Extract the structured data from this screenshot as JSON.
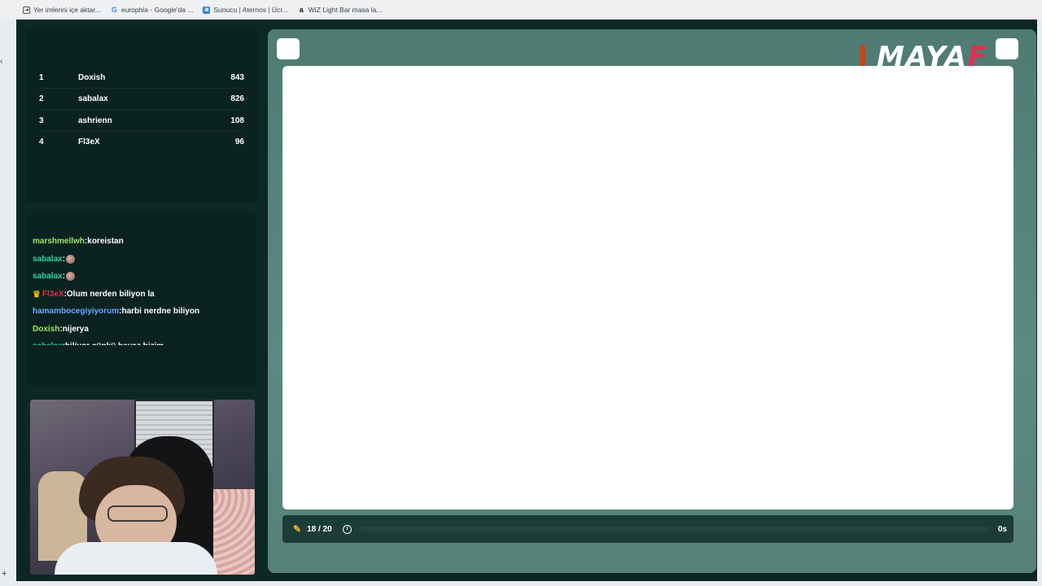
{
  "bookmarks": [
    {
      "label": "Yer imlerini içe aktar...",
      "icon": "import-icon"
    },
    {
      "label": "europhia - Google'da ...",
      "icon": "google-icon"
    },
    {
      "label": "Sunucu | Aternos | Ücr...",
      "icon": "aternos-icon"
    },
    {
      "label": "WiZ Light Bar masa la...",
      "icon": "amazon-icon"
    }
  ],
  "leaderboard": [
    {
      "rank": "1",
      "name": "Doxish",
      "score": "843"
    },
    {
      "rank": "2",
      "name": "sabalax",
      "score": "826"
    },
    {
      "rank": "3",
      "name": "ashrienn",
      "score": "108"
    },
    {
      "rank": "4",
      "name": "Fl3eX",
      "score": "96"
    }
  ],
  "chat": [
    {
      "user": "marshmellwh",
      "user_color": "#9ee66a",
      "text": "koreistan",
      "emote": false,
      "crown": false
    },
    {
      "user": "sabalax",
      "user_color": "#2dd6a4",
      "text": "",
      "emote": true,
      "crown": false
    },
    {
      "user": "sabalax",
      "user_color": "#2dd6a4",
      "text": "",
      "emote": true,
      "crown": false
    },
    {
      "user": "Fl3eX",
      "user_color": "#e0304d",
      "text": "Olum nerden biliyon la",
      "emote": false,
      "crown": true
    },
    {
      "user": "hamambocegiyiyorum",
      "user_color": "#6aa8ff",
      "text": "harbi nerdne biliyon",
      "emote": false,
      "crown": false
    },
    {
      "user": "Doxish",
      "user_color": "#9ee66a",
      "text": "nijerya",
      "emote": false,
      "crown": false
    },
    {
      "user": "sabalax",
      "user_color": "#2dd6a4",
      "text": "biliyor çünkü beyaz bizim",
      "emote": false,
      "crown": false
    }
  ],
  "game": {
    "logo_main": "MAYA",
    "logo_accent": "F",
    "round": "18 / 20",
    "time": "0s",
    "progress": 0.0
  },
  "colors": {
    "frame_bg": "#0d2824",
    "panel_bg": "#4f7b73",
    "logo_accent": "#e0304d",
    "pencil": "#f0b429"
  }
}
